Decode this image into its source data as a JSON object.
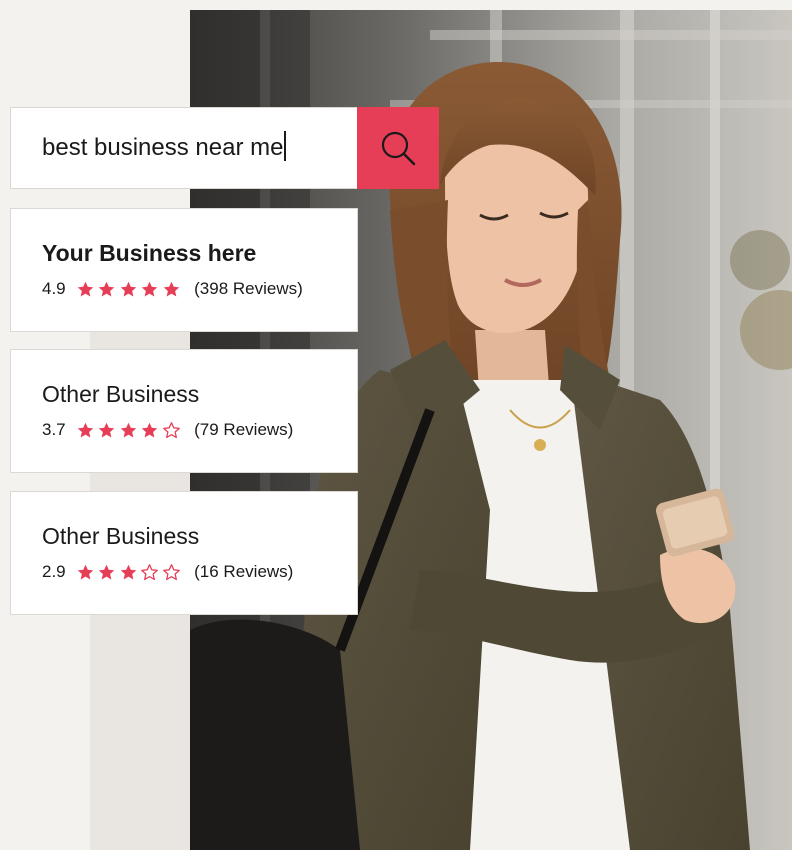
{
  "search": {
    "query": "best business near me",
    "button_icon": "search-icon"
  },
  "colors": {
    "accent": "#e63e56",
    "background": "#f4f2ef"
  },
  "results": [
    {
      "name": "Your Business here",
      "rating": "4.9",
      "stars": 5,
      "reviews": "(398 Reviews)",
      "highlighted": true
    },
    {
      "name": "Other Business",
      "rating": "3.7",
      "stars": 4,
      "reviews": "(79 Reviews)",
      "highlighted": false
    },
    {
      "name": "Other Business",
      "rating": "2.9",
      "stars": 3,
      "reviews": "(16 Reviews)",
      "highlighted": false
    }
  ]
}
